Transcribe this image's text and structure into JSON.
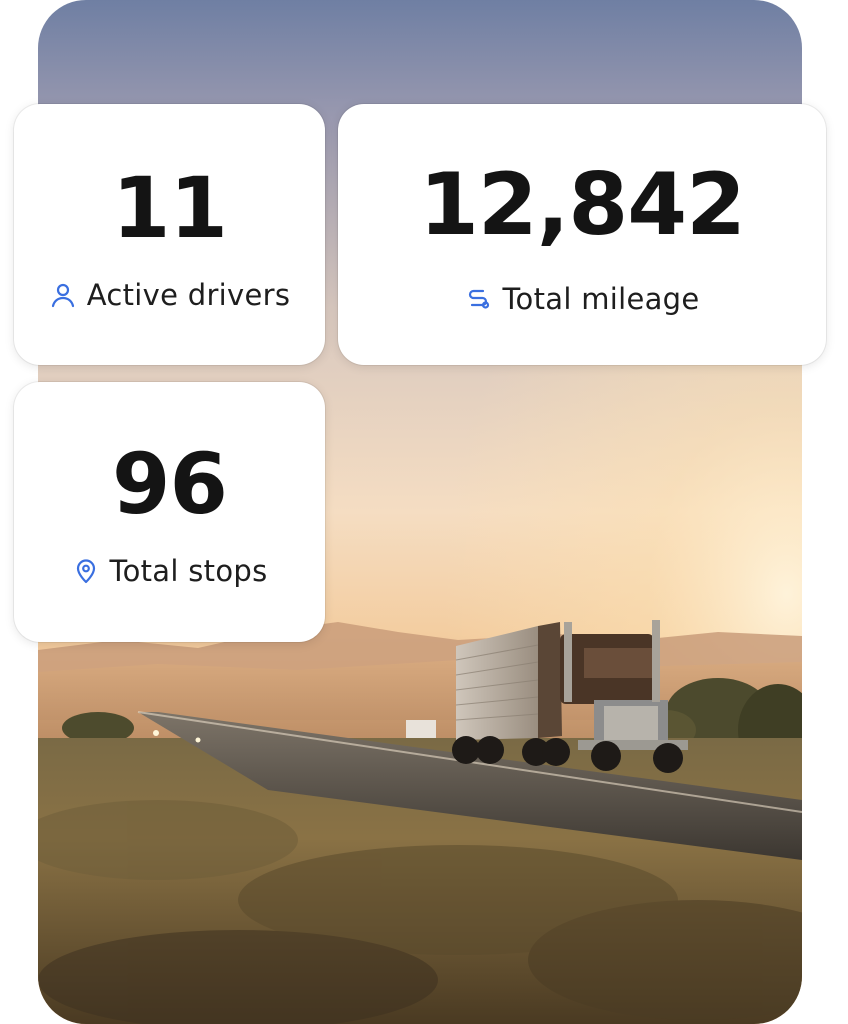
{
  "stats": {
    "drivers": {
      "value": "11",
      "label": "Active drivers",
      "icon": "user-icon"
    },
    "mileage": {
      "value": "12,842",
      "label": "Total mileage",
      "icon": "route-icon"
    },
    "stops": {
      "value": "96",
      "label": "Total stops",
      "icon": "map-pin-icon"
    }
  },
  "colors": {
    "accent": "#3a6fe0",
    "text": "#141414",
    "card_background": "#ffffff"
  },
  "background_image": {
    "icon": "truck-highway-sunset-photo"
  }
}
